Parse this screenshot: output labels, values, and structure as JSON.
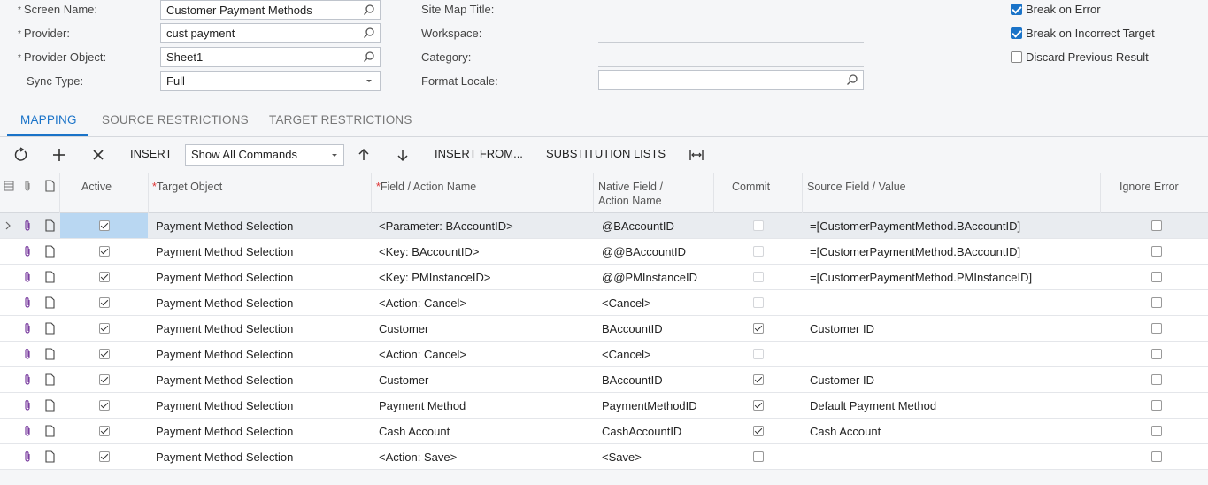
{
  "form": {
    "screen_name_label": "Screen Name:",
    "screen_name_value": "Customer Payment Methods",
    "provider_label": "Provider:",
    "provider_value": "cust payment",
    "provider_object_label": "Provider Object:",
    "provider_object_value": "Sheet1",
    "sync_type_label": "Sync Type:",
    "sync_type_value": "Full",
    "site_map_title_label": "Site Map Title:",
    "workspace_label": "Workspace:",
    "category_label": "Category:",
    "format_locale_label": "Format Locale:",
    "required_mark": "*"
  },
  "options": {
    "break_on_error": {
      "label": "Break on Error",
      "checked": true
    },
    "break_on_incorrect_target": {
      "label": "Break on Incorrect Target",
      "checked": true
    },
    "discard_previous_result": {
      "label": "Discard Previous Result",
      "checked": false
    }
  },
  "tabs": [
    {
      "label": "MAPPING",
      "active": true
    },
    {
      "label": "SOURCE RESTRICTIONS",
      "active": false
    },
    {
      "label": "TARGET RESTRICTIONS",
      "active": false
    }
  ],
  "toolbar": {
    "insert_label": "INSERT",
    "commands_select": "Show All Commands",
    "insert_from_label": "INSERT FROM...",
    "substitution_lists_label": "SUBSTITUTION LISTS",
    "icons": [
      "refresh-icon",
      "plus-icon",
      "close-icon",
      "arrow-up-icon",
      "arrow-down-icon",
      "fit-columns-icon"
    ]
  },
  "grid": {
    "headers": {
      "active": "Active",
      "target_object": "Target Object",
      "field_action": "Field / Action Name",
      "native_field_1": "Native Field /",
      "native_field_2": "Action Name",
      "commit": "Commit",
      "source_field": "Source Field / Value",
      "ignore_error": "Ignore Error"
    },
    "rows": [
      {
        "active": true,
        "target": "Payment Method Selection",
        "field": "<Parameter: BAccountID>",
        "native": "@BAccountID",
        "commit": false,
        "commit_enabled": false,
        "source": "=[CustomerPaymentMethod.BAccountID]",
        "ignore": false
      },
      {
        "active": true,
        "target": "Payment Method Selection",
        "field": "<Key: BAccountID>",
        "native": "@@BAccountID",
        "commit": false,
        "commit_enabled": false,
        "source": "=[CustomerPaymentMethod.BAccountID]",
        "ignore": false
      },
      {
        "active": true,
        "target": "Payment Method Selection",
        "field": "<Key: PMInstanceID>",
        "native": "@@PMInstanceID",
        "commit": false,
        "commit_enabled": false,
        "source": "=[CustomerPaymentMethod.PMInstanceID]",
        "ignore": false
      },
      {
        "active": true,
        "target": "Payment Method Selection",
        "field": "<Action: Cancel>",
        "native": "<Cancel>",
        "commit": false,
        "commit_enabled": false,
        "source": "",
        "ignore": false
      },
      {
        "active": true,
        "target": "Payment Method Selection",
        "field": "Customer",
        "native": "BAccountID",
        "commit": true,
        "commit_enabled": true,
        "source": "Customer ID",
        "ignore": false
      },
      {
        "active": true,
        "target": "Payment Method Selection",
        "field": "<Action: Cancel>",
        "native": "<Cancel>",
        "commit": false,
        "commit_enabled": false,
        "source": "",
        "ignore": false
      },
      {
        "active": true,
        "target": "Payment Method Selection",
        "field": "Customer",
        "native": "BAccountID",
        "commit": true,
        "commit_enabled": true,
        "source": "Customer ID",
        "ignore": false
      },
      {
        "active": true,
        "target": "Payment Method Selection",
        "field": "Payment Method",
        "native": "PaymentMethodID",
        "commit": true,
        "commit_enabled": true,
        "source": "Default Payment Method",
        "ignore": false
      },
      {
        "active": true,
        "target": "Payment Method Selection",
        "field": "Cash Account",
        "native": "CashAccountID",
        "commit": true,
        "commit_enabled": true,
        "source": "Cash Account",
        "ignore": false
      },
      {
        "active": true,
        "target": "Payment Method Selection",
        "field": "<Action: Save>",
        "native": "<Save>",
        "commit": false,
        "commit_enabled": true,
        "source": "",
        "ignore": false
      }
    ]
  },
  "colors": {
    "accent": "#1a73c8",
    "selected_cell": "#b9d7f2"
  }
}
